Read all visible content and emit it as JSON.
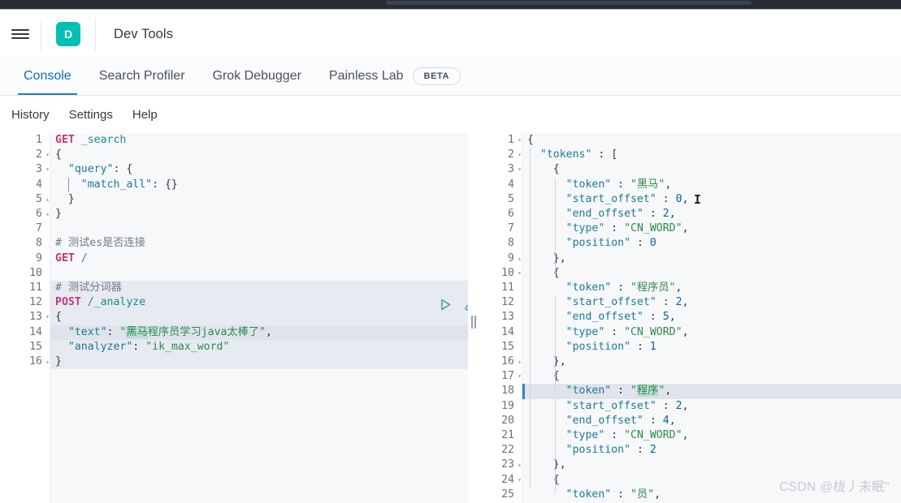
{
  "browser": {
    "omnibox_placeholder": ""
  },
  "header": {
    "menu_icon": "hamburger-menu-icon",
    "logo_letter": "D",
    "title": "Dev Tools",
    "accent_color": "#00bfb3"
  },
  "tabs": {
    "items": [
      {
        "label": "Console",
        "active": true
      },
      {
        "label": "Search Profiler",
        "active": false
      },
      {
        "label": "Grok Debugger",
        "active": false
      },
      {
        "label": "Painless Lab",
        "active": false,
        "badge": "BETA"
      }
    ],
    "active_color": "#0a6ebd"
  },
  "subnav": {
    "items": [
      {
        "label": "History"
      },
      {
        "label": "Settings"
      },
      {
        "label": "Help"
      }
    ]
  },
  "actions": {
    "run_icon": "play-triangle-icon",
    "wrench_icon": "wrench-icon",
    "run_color": "#4a9d8e",
    "wrench_color": "#5b8fc9"
  },
  "request_editor": {
    "name": "console-request-editor",
    "lines": [
      {
        "n": "1",
        "fold": "",
        "tokens": [
          {
            "t": "GET ",
            "c": "k-method"
          },
          {
            "t": "_search",
            "c": "k-url"
          }
        ]
      },
      {
        "n": "2",
        "fold": "▾",
        "tokens": [
          {
            "t": "{",
            "c": "k-punc"
          }
        ]
      },
      {
        "n": "3",
        "fold": "▾",
        "tokens": [
          {
            "t": "  ",
            "c": "k-punc"
          },
          {
            "t": "\"query\"",
            "c": "k-key"
          },
          {
            "t": ": {",
            "c": "k-punc"
          }
        ]
      },
      {
        "n": "4",
        "fold": "",
        "tokens": [
          {
            "t": "    ",
            "c": "k-punc"
          },
          {
            "t": "\"match_all\"",
            "c": "k-key"
          },
          {
            "t": ": {}",
            "c": "k-punc"
          }
        ]
      },
      {
        "n": "5",
        "fold": "▴",
        "tokens": [
          {
            "t": "  }",
            "c": "k-punc"
          }
        ]
      },
      {
        "n": "6",
        "fold": "▴",
        "tokens": [
          {
            "t": "}",
            "c": "k-punc"
          }
        ]
      },
      {
        "n": "7",
        "fold": "",
        "tokens": [
          {
            "t": "",
            "c": "k-punc"
          }
        ]
      },
      {
        "n": "8",
        "fold": "",
        "tokens": [
          {
            "t": "# 测试es是否连接",
            "c": "k-comment"
          }
        ]
      },
      {
        "n": "9",
        "fold": "",
        "tokens": [
          {
            "t": "GET ",
            "c": "k-method"
          },
          {
            "t": "/",
            "c": "k-url"
          }
        ]
      },
      {
        "n": "10",
        "fold": "",
        "tokens": [
          {
            "t": "",
            "c": "k-punc"
          }
        ]
      },
      {
        "n": "11",
        "fold": "",
        "tokens": [
          {
            "t": "# 测试分词器",
            "c": "k-comment"
          }
        ],
        "block": true
      },
      {
        "n": "12",
        "fold": "",
        "tokens": [
          {
            "t": "POST ",
            "c": "k-method"
          },
          {
            "t": "/_analyze",
            "c": "k-url"
          }
        ],
        "block": true
      },
      {
        "n": "13",
        "fold": "▾",
        "tokens": [
          {
            "t": "{",
            "c": "k-punc"
          }
        ],
        "block": true
      },
      {
        "n": "14",
        "fold": "",
        "tokens": [
          {
            "t": "  ",
            "c": "k-punc"
          },
          {
            "t": "\"text\"",
            "c": "k-key"
          },
          {
            "t": ": ",
            "c": "k-punc"
          },
          {
            "t": "\"",
            "c": "k-string"
          },
          {
            "t": "黑马",
            "c": "k-cn sel"
          },
          {
            "t": "程序员学习java太棒了\"",
            "c": "k-string"
          },
          {
            "t": ",",
            "c": "k-punc"
          }
        ],
        "block": true,
        "highlight": true
      },
      {
        "n": "15",
        "fold": "",
        "tokens": [
          {
            "t": "  ",
            "c": "k-punc"
          },
          {
            "t": "\"analyzer\"",
            "c": "k-key"
          },
          {
            "t": ": ",
            "c": "k-punc"
          },
          {
            "t": "\"ik_max_word\"",
            "c": "k-string"
          }
        ],
        "block": true
      },
      {
        "n": "16",
        "fold": "▴",
        "tokens": [
          {
            "t": "}",
            "c": "k-punc"
          }
        ],
        "block": true
      }
    ]
  },
  "response_viewer": {
    "name": "console-response-viewer",
    "lines": [
      {
        "n": "1",
        "fold": "▾",
        "tokens": [
          {
            "t": "{",
            "c": "k-punc"
          }
        ]
      },
      {
        "n": "2",
        "fold": "▾",
        "tokens": [
          {
            "t": "  ",
            "c": "k-punc"
          },
          {
            "t": "\"tokens\"",
            "c": "k-key"
          },
          {
            "t": " : [",
            "c": "k-punc"
          }
        ]
      },
      {
        "n": "3",
        "fold": "▾",
        "tokens": [
          {
            "t": "    {",
            "c": "k-punc"
          }
        ]
      },
      {
        "n": "4",
        "fold": "",
        "tokens": [
          {
            "t": "      ",
            "c": "k-punc"
          },
          {
            "t": "\"token\"",
            "c": "k-key"
          },
          {
            "t": " : ",
            "c": "k-punc"
          },
          {
            "t": "\"黑马\"",
            "c": "k-string"
          },
          {
            "t": ",",
            "c": "k-punc"
          }
        ]
      },
      {
        "n": "5",
        "fold": "",
        "tokens": [
          {
            "t": "      ",
            "c": "k-punc"
          },
          {
            "t": "\"start_offset\"",
            "c": "k-key"
          },
          {
            "t": " : ",
            "c": "k-punc"
          },
          {
            "t": "0",
            "c": "k-num"
          },
          {
            "t": ",",
            "c": "k-punc"
          }
        ]
      },
      {
        "n": "6",
        "fold": "",
        "tokens": [
          {
            "t": "      ",
            "c": "k-punc"
          },
          {
            "t": "\"end_offset\"",
            "c": "k-key"
          },
          {
            "t": " : ",
            "c": "k-punc"
          },
          {
            "t": "2",
            "c": "k-num"
          },
          {
            "t": ",",
            "c": "k-punc"
          }
        ]
      },
      {
        "n": "7",
        "fold": "",
        "tokens": [
          {
            "t": "      ",
            "c": "k-punc"
          },
          {
            "t": "\"type\"",
            "c": "k-key"
          },
          {
            "t": " : ",
            "c": "k-punc"
          },
          {
            "t": "\"CN_WORD\"",
            "c": "k-string"
          },
          {
            "t": ",",
            "c": "k-punc"
          }
        ]
      },
      {
        "n": "8",
        "fold": "",
        "tokens": [
          {
            "t": "      ",
            "c": "k-punc"
          },
          {
            "t": "\"position\"",
            "c": "k-key"
          },
          {
            "t": " : ",
            "c": "k-punc"
          },
          {
            "t": "0",
            "c": "k-num"
          }
        ]
      },
      {
        "n": "9",
        "fold": "▴",
        "tokens": [
          {
            "t": "    },",
            "c": "k-punc"
          }
        ]
      },
      {
        "n": "10",
        "fold": "▾",
        "tokens": [
          {
            "t": "    {",
            "c": "k-punc"
          }
        ]
      },
      {
        "n": "11",
        "fold": "",
        "tokens": [
          {
            "t": "      ",
            "c": "k-punc"
          },
          {
            "t": "\"token\"",
            "c": "k-key"
          },
          {
            "t": " : ",
            "c": "k-punc"
          },
          {
            "t": "\"程序员\"",
            "c": "k-string"
          },
          {
            "t": ",",
            "c": "k-punc"
          }
        ]
      },
      {
        "n": "12",
        "fold": "",
        "tokens": [
          {
            "t": "      ",
            "c": "k-punc"
          },
          {
            "t": "\"start_offset\"",
            "c": "k-key"
          },
          {
            "t": " : ",
            "c": "k-punc"
          },
          {
            "t": "2",
            "c": "k-num"
          },
          {
            "t": ",",
            "c": "k-punc"
          }
        ]
      },
      {
        "n": "13",
        "fold": "",
        "tokens": [
          {
            "t": "      ",
            "c": "k-punc"
          },
          {
            "t": "\"end_offset\"",
            "c": "k-key"
          },
          {
            "t": " : ",
            "c": "k-punc"
          },
          {
            "t": "5",
            "c": "k-num"
          },
          {
            "t": ",",
            "c": "k-punc"
          }
        ]
      },
      {
        "n": "14",
        "fold": "",
        "tokens": [
          {
            "t": "      ",
            "c": "k-punc"
          },
          {
            "t": "\"type\"",
            "c": "k-key"
          },
          {
            "t": " : ",
            "c": "k-punc"
          },
          {
            "t": "\"CN_WORD\"",
            "c": "k-string"
          },
          {
            "t": ",",
            "c": "k-punc"
          }
        ]
      },
      {
        "n": "15",
        "fold": "",
        "tokens": [
          {
            "t": "      ",
            "c": "k-punc"
          },
          {
            "t": "\"position\"",
            "c": "k-key"
          },
          {
            "t": " : ",
            "c": "k-punc"
          },
          {
            "t": "1",
            "c": "k-num"
          }
        ]
      },
      {
        "n": "16",
        "fold": "▴",
        "tokens": [
          {
            "t": "    },",
            "c": "k-punc"
          }
        ]
      },
      {
        "n": "17",
        "fold": "▾",
        "tokens": [
          {
            "t": "    {",
            "c": "k-punc"
          }
        ]
      },
      {
        "n": "18",
        "fold": "",
        "tokens": [
          {
            "t": "      ",
            "c": "k-punc"
          },
          {
            "t": "\"token\"",
            "c": "k-key"
          },
          {
            "t": " : ",
            "c": "k-punc"
          },
          {
            "t": "\"",
            "c": "k-string"
          },
          {
            "t": "程序",
            "c": "k-cn sel"
          },
          {
            "t": "\"",
            "c": "k-string"
          },
          {
            "t": ",",
            "c": "k-punc"
          }
        ],
        "highlight": true,
        "marker": true
      },
      {
        "n": "19",
        "fold": "",
        "tokens": [
          {
            "t": "      ",
            "c": "k-punc"
          },
          {
            "t": "\"start_offset\"",
            "c": "k-key"
          },
          {
            "t": " : ",
            "c": "k-punc"
          },
          {
            "t": "2",
            "c": "k-num"
          },
          {
            "t": ",",
            "c": "k-punc"
          }
        ]
      },
      {
        "n": "20",
        "fold": "",
        "tokens": [
          {
            "t": "      ",
            "c": "k-punc"
          },
          {
            "t": "\"end_offset\"",
            "c": "k-key"
          },
          {
            "t": " : ",
            "c": "k-punc"
          },
          {
            "t": "4",
            "c": "k-num"
          },
          {
            "t": ",",
            "c": "k-punc"
          }
        ]
      },
      {
        "n": "21",
        "fold": "",
        "tokens": [
          {
            "t": "      ",
            "c": "k-punc"
          },
          {
            "t": "\"type\"",
            "c": "k-key"
          },
          {
            "t": " : ",
            "c": "k-punc"
          },
          {
            "t": "\"CN_WORD\"",
            "c": "k-string"
          },
          {
            "t": ",",
            "c": "k-punc"
          }
        ]
      },
      {
        "n": "22",
        "fold": "",
        "tokens": [
          {
            "t": "      ",
            "c": "k-punc"
          },
          {
            "t": "\"position\"",
            "c": "k-key"
          },
          {
            "t": " : ",
            "c": "k-punc"
          },
          {
            "t": "2",
            "c": "k-num"
          }
        ]
      },
      {
        "n": "23",
        "fold": "▴",
        "tokens": [
          {
            "t": "    },",
            "c": "k-punc"
          }
        ]
      },
      {
        "n": "24",
        "fold": "▾",
        "tokens": [
          {
            "t": "    {",
            "c": "k-punc"
          }
        ]
      },
      {
        "n": "25",
        "fold": "",
        "tokens": [
          {
            "t": "      ",
            "c": "k-punc"
          },
          {
            "t": "\"token\"",
            "c": "k-key"
          },
          {
            "t": " : ",
            "c": "k-punc"
          },
          {
            "t": "\"员\"",
            "c": "k-string"
          },
          {
            "t": ",",
            "c": "k-punc"
          }
        ]
      }
    ]
  },
  "splitter": {
    "name": "pane-splitter"
  },
  "watermark": {
    "text": "CSDN @栊丿未眠\""
  }
}
